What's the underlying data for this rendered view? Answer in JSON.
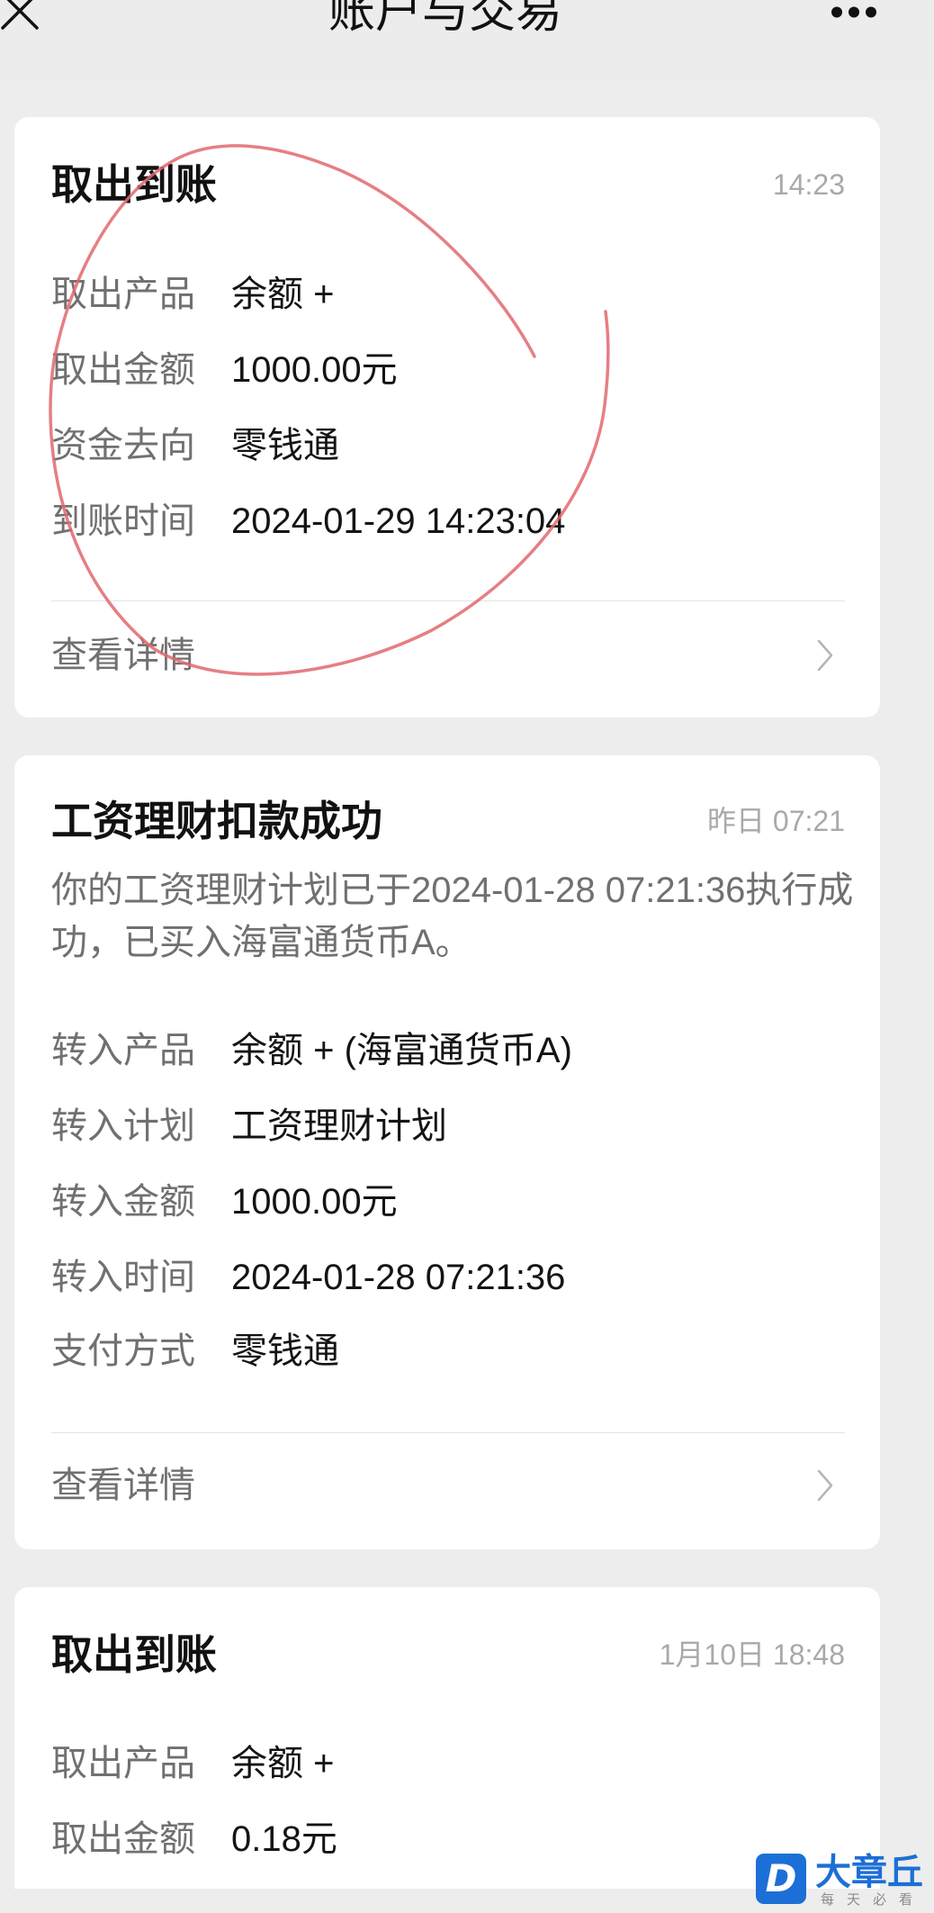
{
  "header": {
    "title": "账户与交易",
    "close_icon": "close-icon",
    "more_icon": "more-icon"
  },
  "cards": [
    {
      "title": "取出到账",
      "time": "14:23",
      "rows": [
        {
          "label": "取出产品",
          "value": "余额 +"
        },
        {
          "label": "取出金额",
          "value": "1000.00元"
        },
        {
          "label": "资金去向",
          "value": "零钱通"
        },
        {
          "label": "到账时间",
          "value": "2024-01-29 14:23:04"
        }
      ],
      "detail_label": "查看详情"
    },
    {
      "title": "工资理财扣款成功",
      "time": "昨日 07:21",
      "message_lines": [
        "你的工资理财计划已于2024-01-28 07:21:36执行成",
        "功，已买入海富通货币A。"
      ],
      "rows": [
        {
          "label": "转入产品",
          "value": "余额 + (海富通货币A)"
        },
        {
          "label": "转入计划",
          "value": "工资理财计划"
        },
        {
          "label": "转入金额",
          "value": "1000.00元"
        },
        {
          "label": "转入时间",
          "value": "2024-01-28 07:21:36"
        },
        {
          "label": "支付方式",
          "value": "零钱通"
        }
      ],
      "detail_label": "查看详情"
    },
    {
      "title": "取出到账",
      "time": "1月10日 18:48",
      "rows": [
        {
          "label": "取出产品",
          "value": "余额 +"
        },
        {
          "label": "取出金额",
          "value": "0.18元"
        }
      ]
    }
  ],
  "icons": {
    "chevron": "chevron-right-icon"
  },
  "watermark": {
    "logo_letter": "D",
    "name": "大章丘",
    "tagline": "每天必看"
  },
  "colors": {
    "page_background": "#ededed",
    "card_background": "#ffffff",
    "annotation_stroke": "#e0686d",
    "watermark_brand": "#1c6fd6"
  }
}
